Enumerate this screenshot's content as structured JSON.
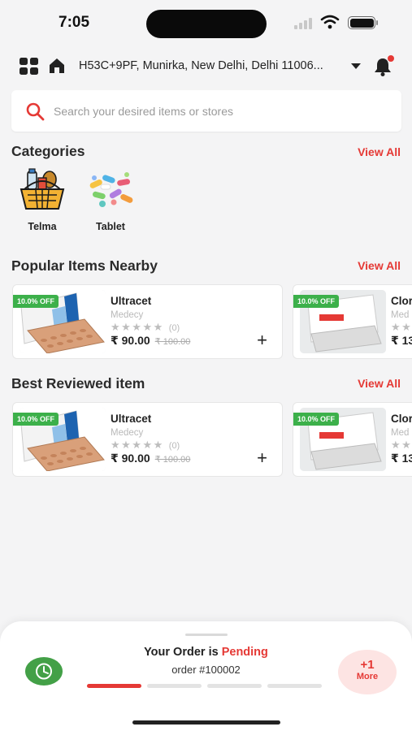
{
  "status_bar": {
    "time": "7:05"
  },
  "header": {
    "address": "H53C+9PF, Munirka, New Delhi, Delhi 11006...",
    "icons": [
      "grid-menu-icon",
      "home-icon",
      "chevron-down-icon",
      "bell-icon"
    ]
  },
  "search": {
    "placeholder": "Search your desired items or stores"
  },
  "categories": {
    "title": "Categories",
    "view_all": "View All",
    "items": [
      {
        "label": "Telma"
      },
      {
        "label": "Tablet"
      }
    ]
  },
  "popular": {
    "title": "Popular Items Nearby",
    "view_all": "View All",
    "items": [
      {
        "badge": "10.0% OFF",
        "name": "Ultracet",
        "store": "Medecy",
        "rating_count": "(0)",
        "price": "₹ 90.00",
        "old_price": "₹ 100.00"
      },
      {
        "badge": "10.0% OFF",
        "name": "Clor",
        "store": "Med",
        "price": "₹ 13"
      }
    ]
  },
  "best_reviewed": {
    "title": "Best Reviewed item",
    "view_all": "View All",
    "items": [
      {
        "badge": "10.0% OFF",
        "name": "Ultracet",
        "store": "Medecy",
        "rating_count": "(0)",
        "price": "₹ 90.00",
        "old_price": "₹ 100.00"
      },
      {
        "badge": "10.0% OFF",
        "name": "Clor",
        "store": "Med",
        "price": "₹ 13"
      }
    ]
  },
  "order": {
    "title_prefix": "Your Order is",
    "status": "Pending",
    "number": "order #100002",
    "progress_steps_done": 1,
    "progress_steps_total": 4,
    "more_count": "+1",
    "more_label": "More"
  },
  "colors": {
    "accent": "#e53935",
    "success": "#43a047",
    "badge": "#3cb04a"
  }
}
